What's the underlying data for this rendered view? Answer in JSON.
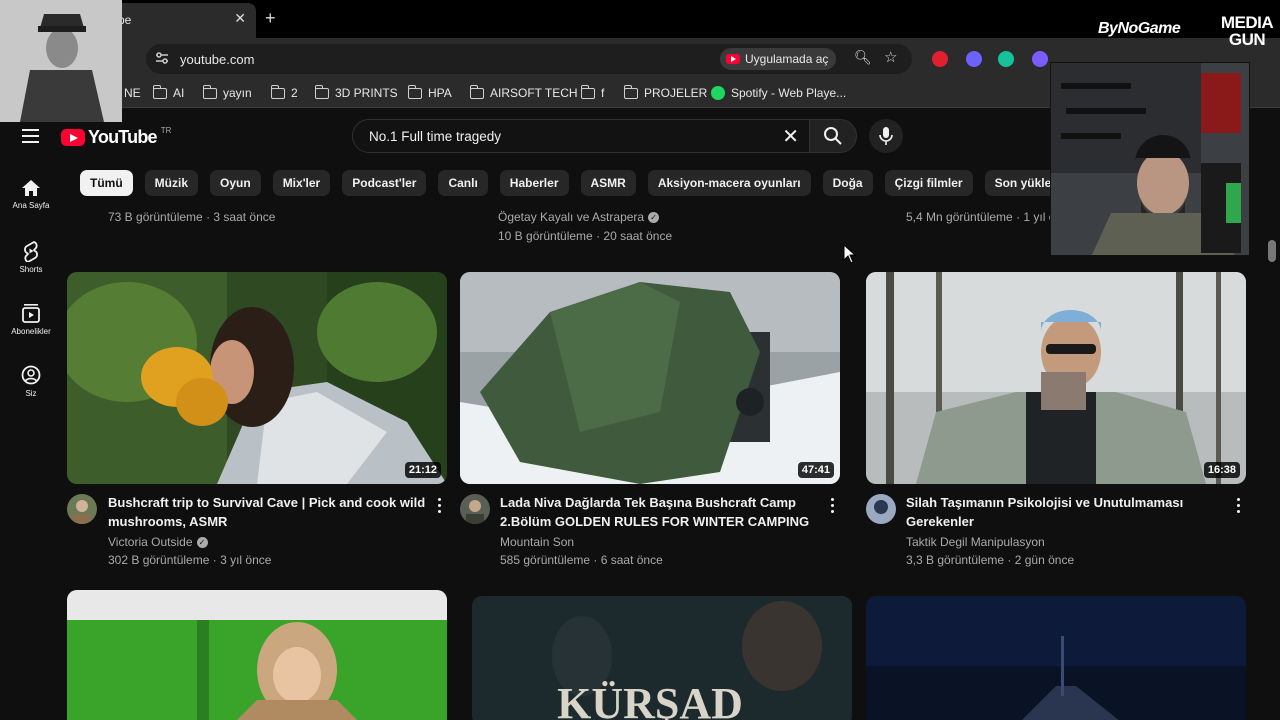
{
  "browser": {
    "tab_title": "be",
    "url": "youtube.com",
    "open_in_app": "Uygulamada aç",
    "bookmarks": [
      "NE",
      "AI",
      "yayın",
      "2",
      "3D PRINTS",
      "HPA",
      "AIRSOFT TECH",
      "f",
      "PROJELER",
      "Spotify - Web Playe..."
    ]
  },
  "youtube": {
    "logo_text": "YouTube",
    "country_code": "TR",
    "search_query": "No.1 Full time tragedy",
    "chips": [
      "Tümü",
      "Müzik",
      "Oyun",
      "Mix'ler",
      "Podcast'ler",
      "Canlı",
      "Haberler",
      "ASMR",
      "Aksiyon-macera oyunları",
      "Doğa",
      "Çizgi filmler",
      "Son yüklenenler"
    ],
    "sidebar": [
      {
        "label": "Ana Sayfa",
        "icon": "home-icon"
      },
      {
        "label": "Shorts",
        "icon": "shorts-icon"
      },
      {
        "label": "Abonelikler",
        "icon": "subscriptions-icon"
      },
      {
        "label": "Siz",
        "icon": "you-icon"
      }
    ],
    "previous_row": {
      "left_stats": "73 B görüntüleme · 3 saat önce",
      "middle_channel": "Ögetay Kayalı ve Astrapera",
      "middle_stats": "10 B görüntüleme · 20 saat önce",
      "right_stats": "5,4 Mn görüntüleme · 1 yıl önce"
    },
    "videos": [
      {
        "title_line1": "Bushcraft trip to Survival Cave | Pick and cook wild",
        "title_line2": "mushrooms, ASMR",
        "channel": "Victoria Outside",
        "verified": true,
        "stats": "302 B görüntüleme · 3 yıl önce",
        "duration": "21:12"
      },
      {
        "title_line1": "Lada Niva Dağlarda Tek Başına Bushcraft Camp",
        "title_line2": "2.Bölüm GOLDEN RULES FOR WINTER CAMPING",
        "channel": "Mountain Son",
        "verified": false,
        "stats": "585 görüntüleme · 6 saat önce",
        "duration": "47:41"
      },
      {
        "title_line1": "Silah Taşımanın Psikolojisi ve Unutulmaması",
        "title_line2": "Gerekenler",
        "channel": "Taktik Degil Manipulasyon",
        "verified": false,
        "stats": "3,3 B görüntüleme · 2 gün önce",
        "duration": "16:38"
      }
    ],
    "next_row_thumb_text": "KÜRŞAD"
  },
  "overlay": {
    "brand_left": "ByNoGame",
    "brand_right_line1": "MEDIA",
    "brand_right_line2": "GUN"
  },
  "colors": {
    "youtube_red": "#ff0033",
    "background": "#0f0f0f",
    "chip_bg": "#272727",
    "spotify_green": "#1ed760"
  }
}
